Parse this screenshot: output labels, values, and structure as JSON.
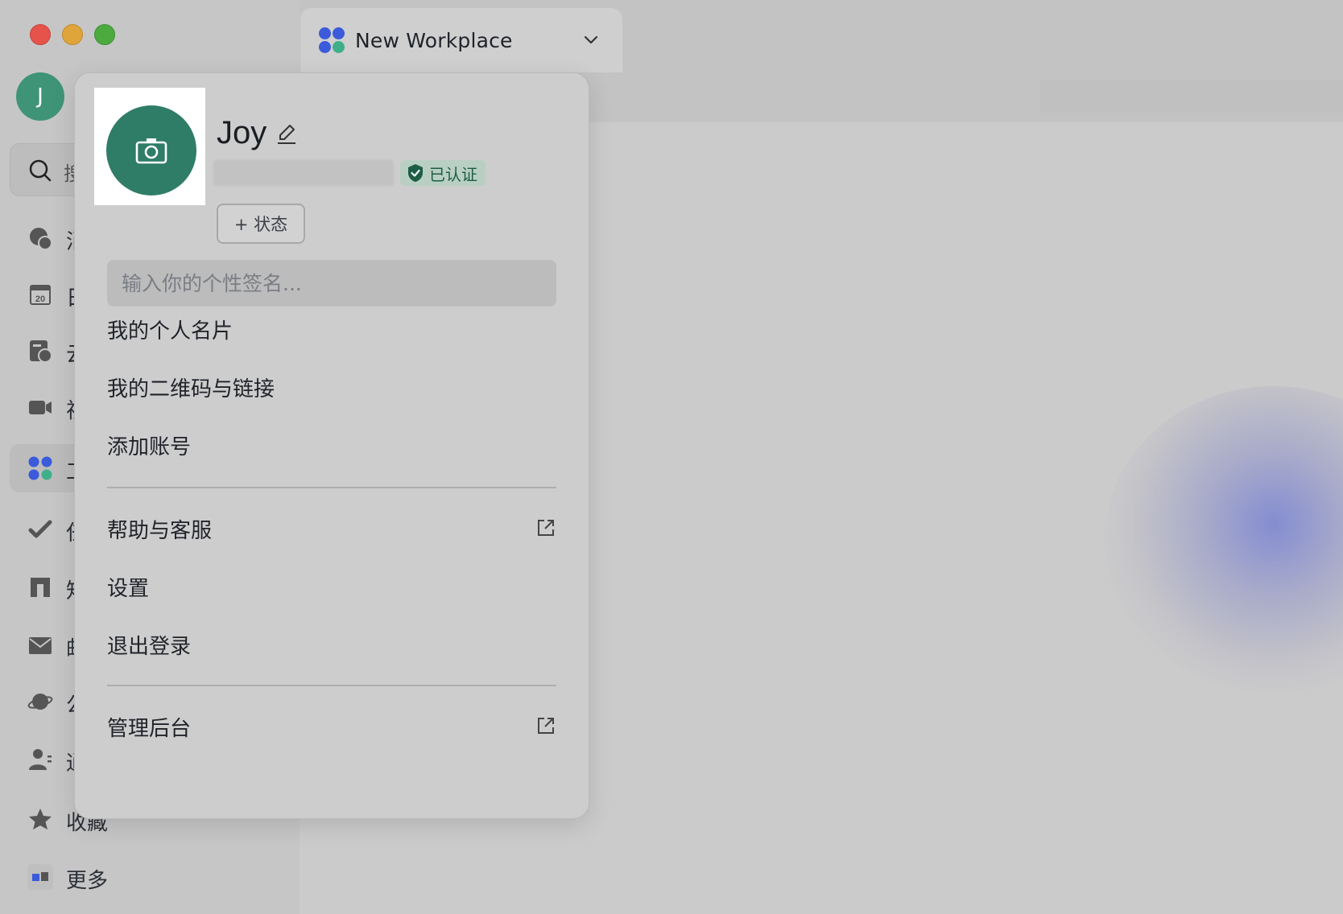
{
  "window": {
    "traffic_lights": [
      "close",
      "minimize",
      "zoom"
    ]
  },
  "workspace_tab": {
    "title": "New Workplace",
    "icon": "workplace-icon",
    "chevron_icon": "chevron-down-icon"
  },
  "sidebar": {
    "avatar_initial": "J",
    "search": {
      "label": "搜",
      "icon": "search-icon"
    },
    "items": [
      {
        "icon": "messages-icon",
        "label": "消",
        "active": false
      },
      {
        "icon": "calendar-icon",
        "label": "日",
        "active": false
      },
      {
        "icon": "cloud-docs-icon",
        "label": "云",
        "active": false
      },
      {
        "icon": "video-meeting-icon",
        "label": "视",
        "active": false
      },
      {
        "icon": "workplace-icon",
        "label": "工",
        "active": true
      },
      {
        "icon": "tasks-icon",
        "label": "任",
        "active": false
      },
      {
        "icon": "knowledge-icon",
        "label": "知",
        "active": false
      },
      {
        "icon": "mail-icon",
        "label": "邮",
        "active": false
      },
      {
        "icon": "planet-icon",
        "label": "公",
        "active": false
      },
      {
        "icon": "contacts-icon",
        "label": "通",
        "active": false
      },
      {
        "icon": "star-icon",
        "label": "收藏",
        "active": false
      },
      {
        "icon": "more-apps-icon",
        "label": "更多",
        "active": false
      }
    ]
  },
  "profile_popup": {
    "name": "Joy",
    "verified_label": "已认证",
    "status_button": "+ 状态",
    "signature_placeholder": "输入你的个性签名...",
    "menu_group_1": [
      {
        "label": "我的个人名片"
      },
      {
        "label": "我的二维码与链接"
      },
      {
        "label": "添加账号"
      }
    ],
    "menu_group_2": [
      {
        "label": "帮助与客服",
        "external": true
      },
      {
        "label": "设置",
        "external": false
      },
      {
        "label": "退出登录",
        "external": false
      }
    ],
    "menu_group_3": [
      {
        "label": "管理后台",
        "external": true
      }
    ]
  },
  "colors": {
    "avatar_green": "#3f9477",
    "verified_green": "#1d5d46",
    "workplace_blue": "#3b5bdb",
    "workplace_green": "#3faf8a"
  }
}
